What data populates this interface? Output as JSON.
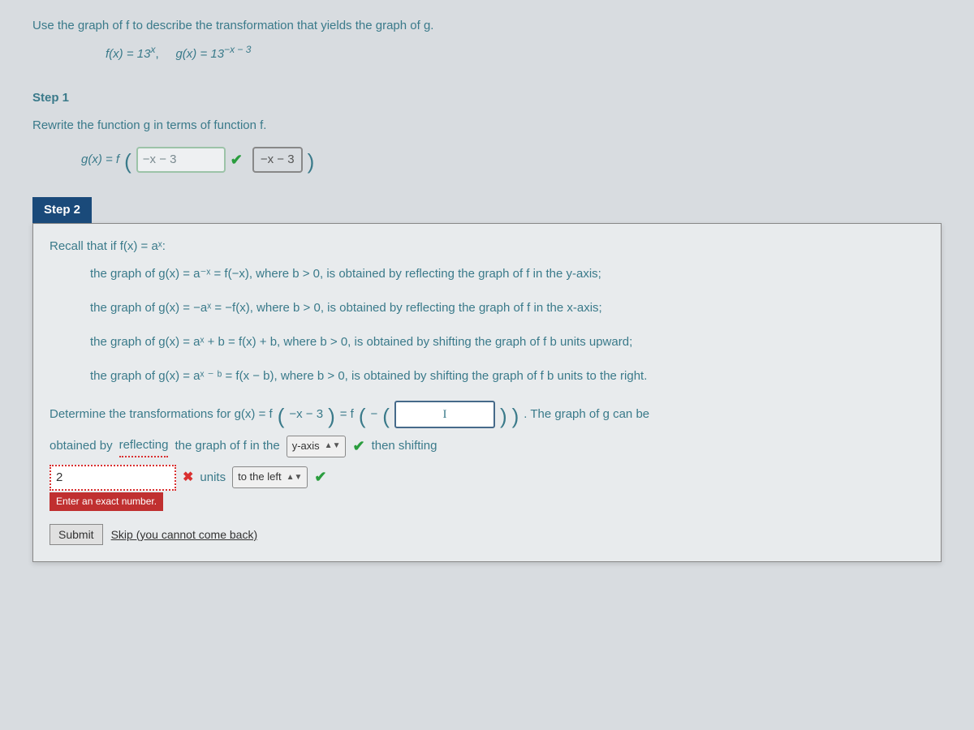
{
  "prompt": "Use the graph of f to describe the transformation that yields the graph of g.",
  "functions": {
    "f_label": "f(x) = 13",
    "f_exp": "x",
    "sep": ",",
    "g_label": "g(x) = 13",
    "g_exp": "−x − 3"
  },
  "step1": {
    "label": "Step 1",
    "desc": "Rewrite the function g in terms of function f.",
    "lhs": "g(x) = f",
    "answer": "−x − 3",
    "hint": "−x − 3"
  },
  "step2": {
    "label": "Step 2",
    "recall": "Recall that if  f(x) = aˣ:",
    "rule1": "the graph of  g(x) = a⁻ˣ = f(−x),  where  b > 0,  is obtained by reflecting the graph of f in the y-axis;",
    "rule2": "the graph of  g(x) = −aˣ = −f(x),  where  b > 0,  is obtained by reflecting the graph of f in the x-axis;",
    "rule3": "the graph of  g(x) = aˣ + b = f(x) + b,  where  b > 0,  is obtained by shifting the graph of f b units upward;",
    "rule4": "the graph of  g(x) = aˣ ⁻ ᵇ = f(x − b),  where  b > 0,  is obtained by shifting the graph of f b units to the right.",
    "determine_pre": "Determine the transformations for  g(x) = f",
    "inner1": "−x − 3",
    "eq": " = f",
    "minus": "−",
    "input_cursor": "I",
    "post": ".  The graph of g can be",
    "obtained_pre": "obtained by",
    "reflect_word": "reflecting",
    "reflect_rest": "the graph of f in the",
    "reflect_select": "y-axis",
    "then": "then shifting",
    "units_input": "2",
    "units_word": "units",
    "direction_select": "to the left",
    "error": "Enter an exact number.",
    "submit": "Submit",
    "skip": "Skip (you cannot come back)"
  }
}
